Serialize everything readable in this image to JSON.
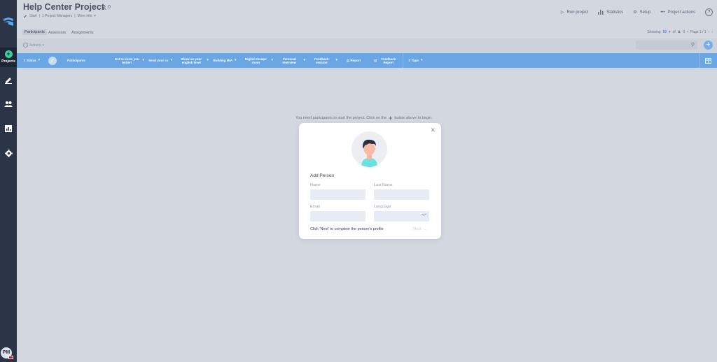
{
  "sidebar": {
    "projects_label": "Projects",
    "user_initials": "PM"
  },
  "header": {
    "title": "Help Center Project",
    "participant_count": "0",
    "subline": {
      "start": "Start",
      "managers": "1 Project Managers",
      "more_info": "More info"
    },
    "actions": {
      "run": "Run project",
      "statistics": "Statistics",
      "setup": "Setup",
      "project_actions": "Project actions",
      "help": "?"
    }
  },
  "tabs": {
    "participants": "Participants",
    "assessors": "Assessors",
    "assignments": "Assignments"
  },
  "paging": {
    "showing": "Showing",
    "per_page": "50",
    "of": "of",
    "count": "0",
    "page": "Page 1 / 1"
  },
  "toolbar": {
    "actions": "Actions"
  },
  "columns": {
    "status": "Status",
    "participants": "Participants",
    "c1": "Get to know you better!",
    "c2": "Send your cv",
    "c3": "Show us your english level",
    "c4": "Building MIA",
    "c5": "Digital Escape room",
    "c6": "Personal Interview",
    "c7": "Feedback session",
    "c8": "Report",
    "c9": "Feedback Report",
    "type": "Type"
  },
  "empty": {
    "before": "You need participants to start the project. Click on the",
    "after": "button above to begin."
  },
  "modal": {
    "title": "Add Person",
    "name_label": "Name",
    "last_name_label": "Last Name",
    "email_label": "Email",
    "language_label": "Language",
    "footer_note": "Click 'Next' to complete the person's profile",
    "next": "Next"
  }
}
